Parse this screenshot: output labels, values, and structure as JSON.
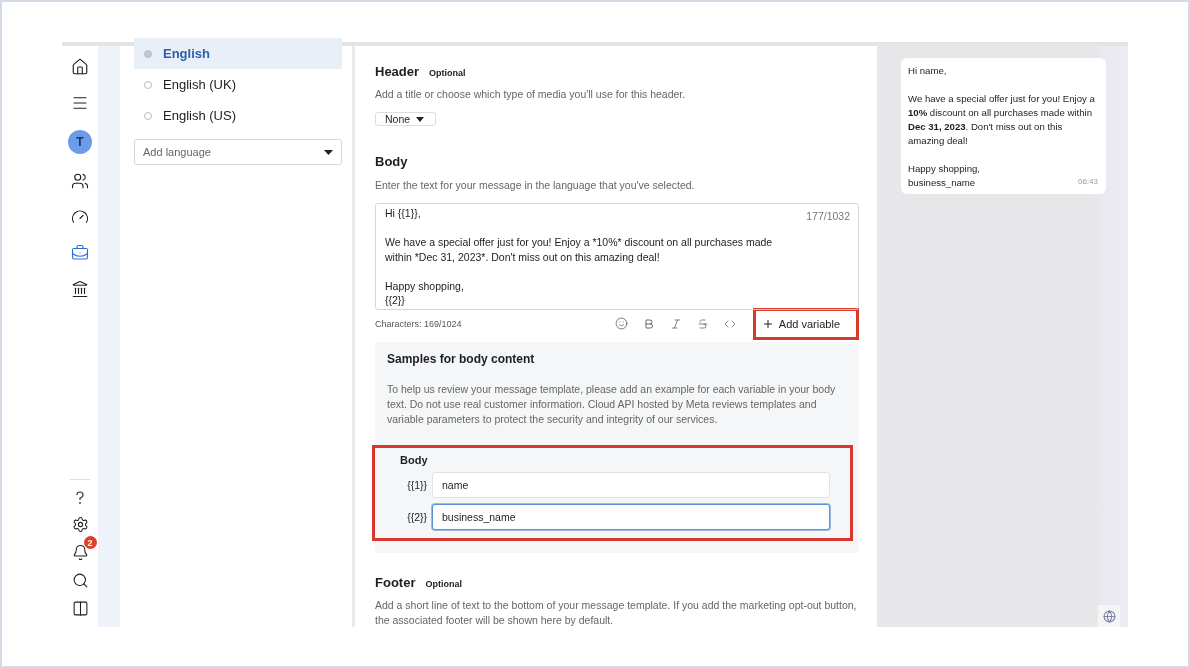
{
  "rail": {
    "avatar": "T",
    "notification_count": "2"
  },
  "languages": [
    {
      "label": "English",
      "selected": true
    },
    {
      "label": "English (UK)",
      "selected": false
    },
    {
      "label": "English (US)",
      "selected": false
    }
  ],
  "add_language": {
    "placeholder": "Add language"
  },
  "header": {
    "title": "Header",
    "tag": "Optional",
    "hint": "Add a title or choose which type of media you'll use for this header.",
    "dropdown": "None"
  },
  "body": {
    "title": "Body",
    "hint": "Enter the text for your message in the language that you've selected.",
    "value": "Hi {{1}},\n\nWe have a special offer just for you! Enjoy a *10%* discount on all purchases made\nwithin *Dec 31, 2023*. Don't miss out on this amazing deal!\n\nHappy shopping,\n{{2}}",
    "counter": "177/1032",
    "characters": "Characters: 169/1024",
    "add_variable": "Add variable",
    "add_variable_highlighted": true
  },
  "samples": {
    "title": "Samples for body content",
    "text": "To help us review your message template, please add an example for each variable in your body text. Do not use real customer information. Cloud API hosted by Meta reviews templates and variable parameters to protect the security and integrity of our services.",
    "group_title": "Body",
    "highlighted": true,
    "variables": [
      {
        "label": "{{1}}",
        "value": "name",
        "focused": false
      },
      {
        "label": "{{2}}",
        "value": "business_name",
        "focused": true
      }
    ]
  },
  "footer": {
    "title": "Footer",
    "tag": "Optional",
    "hint": "Add a short line of text to the bottom of your message template. If you add the marketing opt-out button, the associated footer will be shown here by default."
  },
  "preview": {
    "paragraphs": [
      "Hi name,",
      "We have a special offer just for you! Enjoy a **10%** discount on all purchases made within **Dec 31, 2023**. Don't miss out on this amazing deal!",
      "Happy shopping,\nbusiness_name"
    ],
    "time": "06:43"
  }
}
